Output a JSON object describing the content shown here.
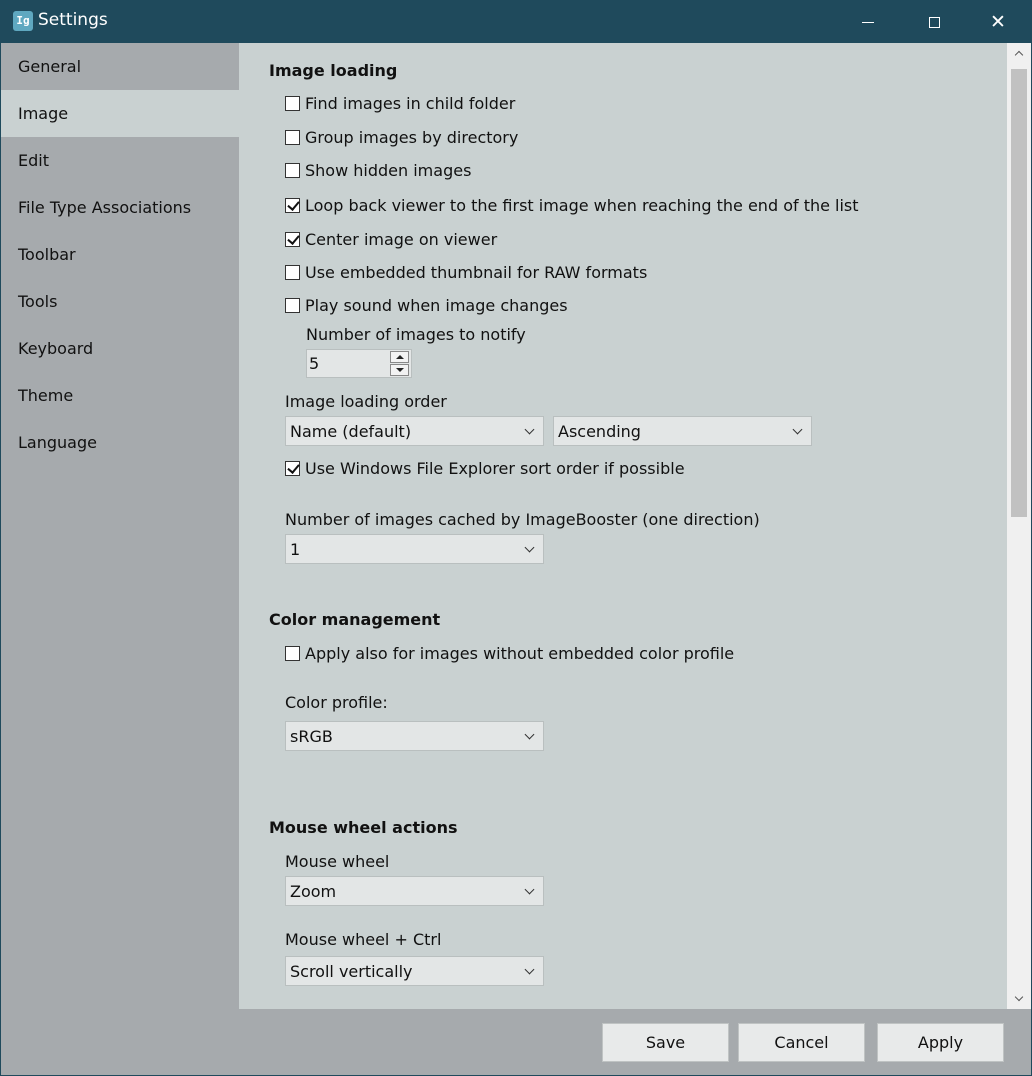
{
  "window": {
    "title": "Settings",
    "app_icon_text": "Ig",
    "minimize_icon": "minimize-icon",
    "maximize_icon": "maximize-icon",
    "close_glyph": "✕"
  },
  "sidebar": {
    "items": [
      {
        "label": "General"
      },
      {
        "label": "Image"
      },
      {
        "label": "Edit"
      },
      {
        "label": "File Type Associations"
      },
      {
        "label": "Toolbar"
      },
      {
        "label": "Tools"
      },
      {
        "label": "Keyboard"
      },
      {
        "label": "Theme"
      },
      {
        "label": "Language"
      }
    ],
    "active": "Image"
  },
  "image_loading": {
    "heading": "Image loading",
    "checkboxes": [
      {
        "label": "Find images in child folder",
        "checked": false
      },
      {
        "label": "Group images by directory",
        "checked": false
      },
      {
        "label": "Show hidden images",
        "checked": false
      },
      {
        "label": "Loop back viewer to the first image when reaching the end of the list",
        "checked": true
      },
      {
        "label": "Center image on viewer",
        "checked": true
      },
      {
        "label": "Use embedded thumbnail for RAW formats",
        "checked": false
      },
      {
        "label": "Play sound when image changes",
        "checked": false
      }
    ],
    "notify_label": "Number of images to notify",
    "notify_value": "5",
    "order_label": "Image loading order",
    "order_value": "Name (default)",
    "direction_value": "Ascending",
    "explorer_sort": {
      "label": "Use Windows File Explorer sort order if possible",
      "checked": true
    },
    "cache_label": "Number of images cached by ImageBooster (one direction)",
    "cache_value": "1"
  },
  "color_management": {
    "heading": "Color management",
    "apply_all": {
      "label": "Apply also for images without embedded color profile",
      "checked": false
    },
    "profile_label": "Color profile:",
    "profile_value": "sRGB"
  },
  "mouse_wheel": {
    "heading": "Mouse wheel actions",
    "wheel_label": "Mouse wheel",
    "wheel_value": "Zoom",
    "ctrl_label": "Mouse wheel + Ctrl",
    "ctrl_value": "Scroll vertically"
  },
  "footer": {
    "save": "Save",
    "cancel": "Cancel",
    "apply": "Apply"
  },
  "colors": {
    "titlebar": "#1f4a5c",
    "sidebar": "#a6aaad",
    "content": "#c9d1d1"
  }
}
